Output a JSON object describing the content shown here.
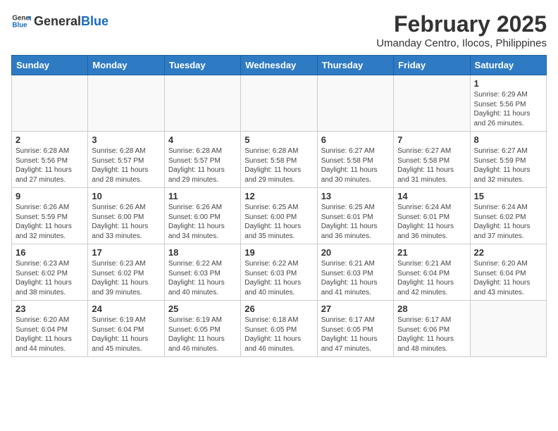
{
  "header": {
    "logo_general": "General",
    "logo_blue": "Blue",
    "month_title": "February 2025",
    "location": "Umanday Centro, Ilocos, Philippines"
  },
  "weekdays": [
    "Sunday",
    "Monday",
    "Tuesday",
    "Wednesday",
    "Thursday",
    "Friday",
    "Saturday"
  ],
  "weeks": [
    [
      {
        "num": "",
        "info": ""
      },
      {
        "num": "",
        "info": ""
      },
      {
        "num": "",
        "info": ""
      },
      {
        "num": "",
        "info": ""
      },
      {
        "num": "",
        "info": ""
      },
      {
        "num": "",
        "info": ""
      },
      {
        "num": "1",
        "info": "Sunrise: 6:29 AM\nSunset: 5:56 PM\nDaylight: 11 hours and 26 minutes."
      }
    ],
    [
      {
        "num": "2",
        "info": "Sunrise: 6:28 AM\nSunset: 5:56 PM\nDaylight: 11 hours and 27 minutes."
      },
      {
        "num": "3",
        "info": "Sunrise: 6:28 AM\nSunset: 5:57 PM\nDaylight: 11 hours and 28 minutes."
      },
      {
        "num": "4",
        "info": "Sunrise: 6:28 AM\nSunset: 5:57 PM\nDaylight: 11 hours and 29 minutes."
      },
      {
        "num": "5",
        "info": "Sunrise: 6:28 AM\nSunset: 5:58 PM\nDaylight: 11 hours and 29 minutes."
      },
      {
        "num": "6",
        "info": "Sunrise: 6:27 AM\nSunset: 5:58 PM\nDaylight: 11 hours and 30 minutes."
      },
      {
        "num": "7",
        "info": "Sunrise: 6:27 AM\nSunset: 5:58 PM\nDaylight: 11 hours and 31 minutes."
      },
      {
        "num": "8",
        "info": "Sunrise: 6:27 AM\nSunset: 5:59 PM\nDaylight: 11 hours and 32 minutes."
      }
    ],
    [
      {
        "num": "9",
        "info": "Sunrise: 6:26 AM\nSunset: 5:59 PM\nDaylight: 11 hours and 32 minutes."
      },
      {
        "num": "10",
        "info": "Sunrise: 6:26 AM\nSunset: 6:00 PM\nDaylight: 11 hours and 33 minutes."
      },
      {
        "num": "11",
        "info": "Sunrise: 6:26 AM\nSunset: 6:00 PM\nDaylight: 11 hours and 34 minutes."
      },
      {
        "num": "12",
        "info": "Sunrise: 6:25 AM\nSunset: 6:00 PM\nDaylight: 11 hours and 35 minutes."
      },
      {
        "num": "13",
        "info": "Sunrise: 6:25 AM\nSunset: 6:01 PM\nDaylight: 11 hours and 36 minutes."
      },
      {
        "num": "14",
        "info": "Sunrise: 6:24 AM\nSunset: 6:01 PM\nDaylight: 11 hours and 36 minutes."
      },
      {
        "num": "15",
        "info": "Sunrise: 6:24 AM\nSunset: 6:02 PM\nDaylight: 11 hours and 37 minutes."
      }
    ],
    [
      {
        "num": "16",
        "info": "Sunrise: 6:23 AM\nSunset: 6:02 PM\nDaylight: 11 hours and 38 minutes."
      },
      {
        "num": "17",
        "info": "Sunrise: 6:23 AM\nSunset: 6:02 PM\nDaylight: 11 hours and 39 minutes."
      },
      {
        "num": "18",
        "info": "Sunrise: 6:22 AM\nSunset: 6:03 PM\nDaylight: 11 hours and 40 minutes."
      },
      {
        "num": "19",
        "info": "Sunrise: 6:22 AM\nSunset: 6:03 PM\nDaylight: 11 hours and 40 minutes."
      },
      {
        "num": "20",
        "info": "Sunrise: 6:21 AM\nSunset: 6:03 PM\nDaylight: 11 hours and 41 minutes."
      },
      {
        "num": "21",
        "info": "Sunrise: 6:21 AM\nSunset: 6:04 PM\nDaylight: 11 hours and 42 minutes."
      },
      {
        "num": "22",
        "info": "Sunrise: 6:20 AM\nSunset: 6:04 PM\nDaylight: 11 hours and 43 minutes."
      }
    ],
    [
      {
        "num": "23",
        "info": "Sunrise: 6:20 AM\nSunset: 6:04 PM\nDaylight: 11 hours and 44 minutes."
      },
      {
        "num": "24",
        "info": "Sunrise: 6:19 AM\nSunset: 6:04 PM\nDaylight: 11 hours and 45 minutes."
      },
      {
        "num": "25",
        "info": "Sunrise: 6:19 AM\nSunset: 6:05 PM\nDaylight: 11 hours and 46 minutes."
      },
      {
        "num": "26",
        "info": "Sunrise: 6:18 AM\nSunset: 6:05 PM\nDaylight: 11 hours and 46 minutes."
      },
      {
        "num": "27",
        "info": "Sunrise: 6:17 AM\nSunset: 6:05 PM\nDaylight: 11 hours and 47 minutes."
      },
      {
        "num": "28",
        "info": "Sunrise: 6:17 AM\nSunset: 6:06 PM\nDaylight: 11 hours and 48 minutes."
      },
      {
        "num": "",
        "info": ""
      }
    ]
  ]
}
